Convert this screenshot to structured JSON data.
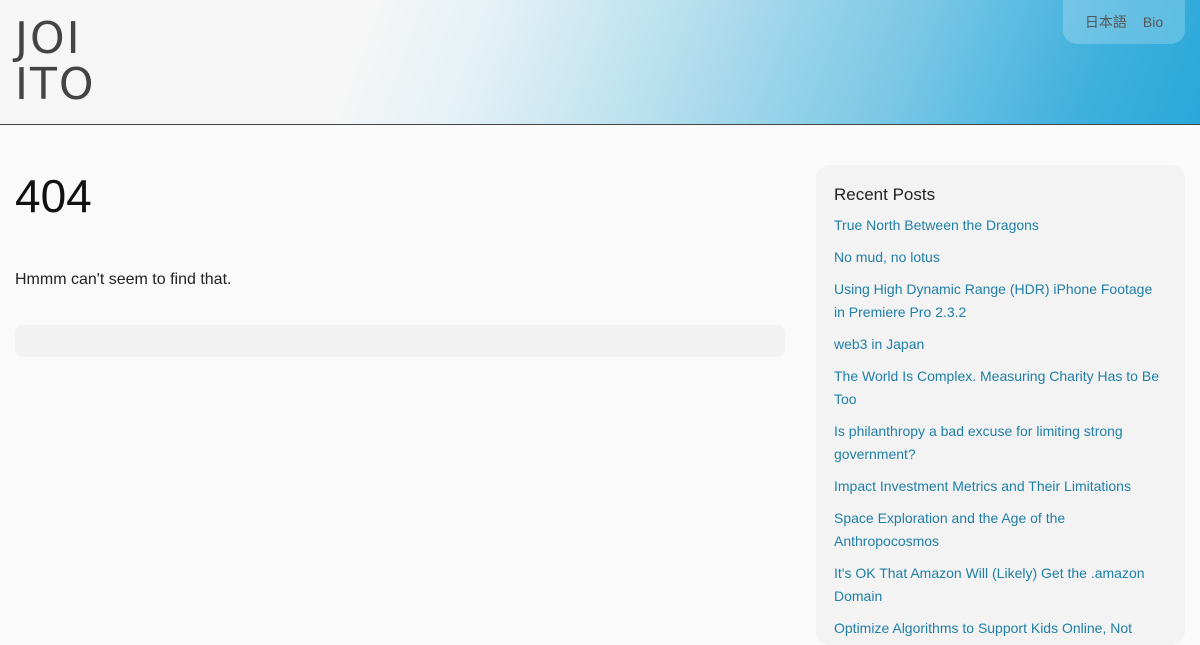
{
  "header": {
    "logo_line1": "JOI",
    "logo_line2": "ITO",
    "nav": [
      {
        "label": "日本語"
      },
      {
        "label": "Bio"
      }
    ]
  },
  "main": {
    "title": "404",
    "message": "Hmmm can't seem to find that."
  },
  "sidebar": {
    "title": "Recent Posts",
    "posts": [
      {
        "label": "True North Between the Dragons"
      },
      {
        "label": "No mud, no lotus"
      },
      {
        "label": "Using High Dynamic Range (HDR) iPhone Footage in Premiere Pro 2.3.2"
      },
      {
        "label": "web3 in Japan"
      },
      {
        "label": "The World Is Complex. Measuring Charity Has to Be Too"
      },
      {
        "label": "Is philanthropy a bad excuse for limiting strong government?"
      },
      {
        "label": "Impact Investment Metrics and Their Limitations"
      },
      {
        "label": "Space Exploration and the Age of the Anthropocosmos"
      },
      {
        "label": "It's OK That Amazon Will (Likely) Get the .amazon Domain"
      },
      {
        "label": "Optimize Algorithms to Support Kids Online, Not Exploit Them"
      }
    ]
  },
  "colors": {
    "link": "#1f7fa8",
    "gradient_end": "#2aa8da"
  }
}
